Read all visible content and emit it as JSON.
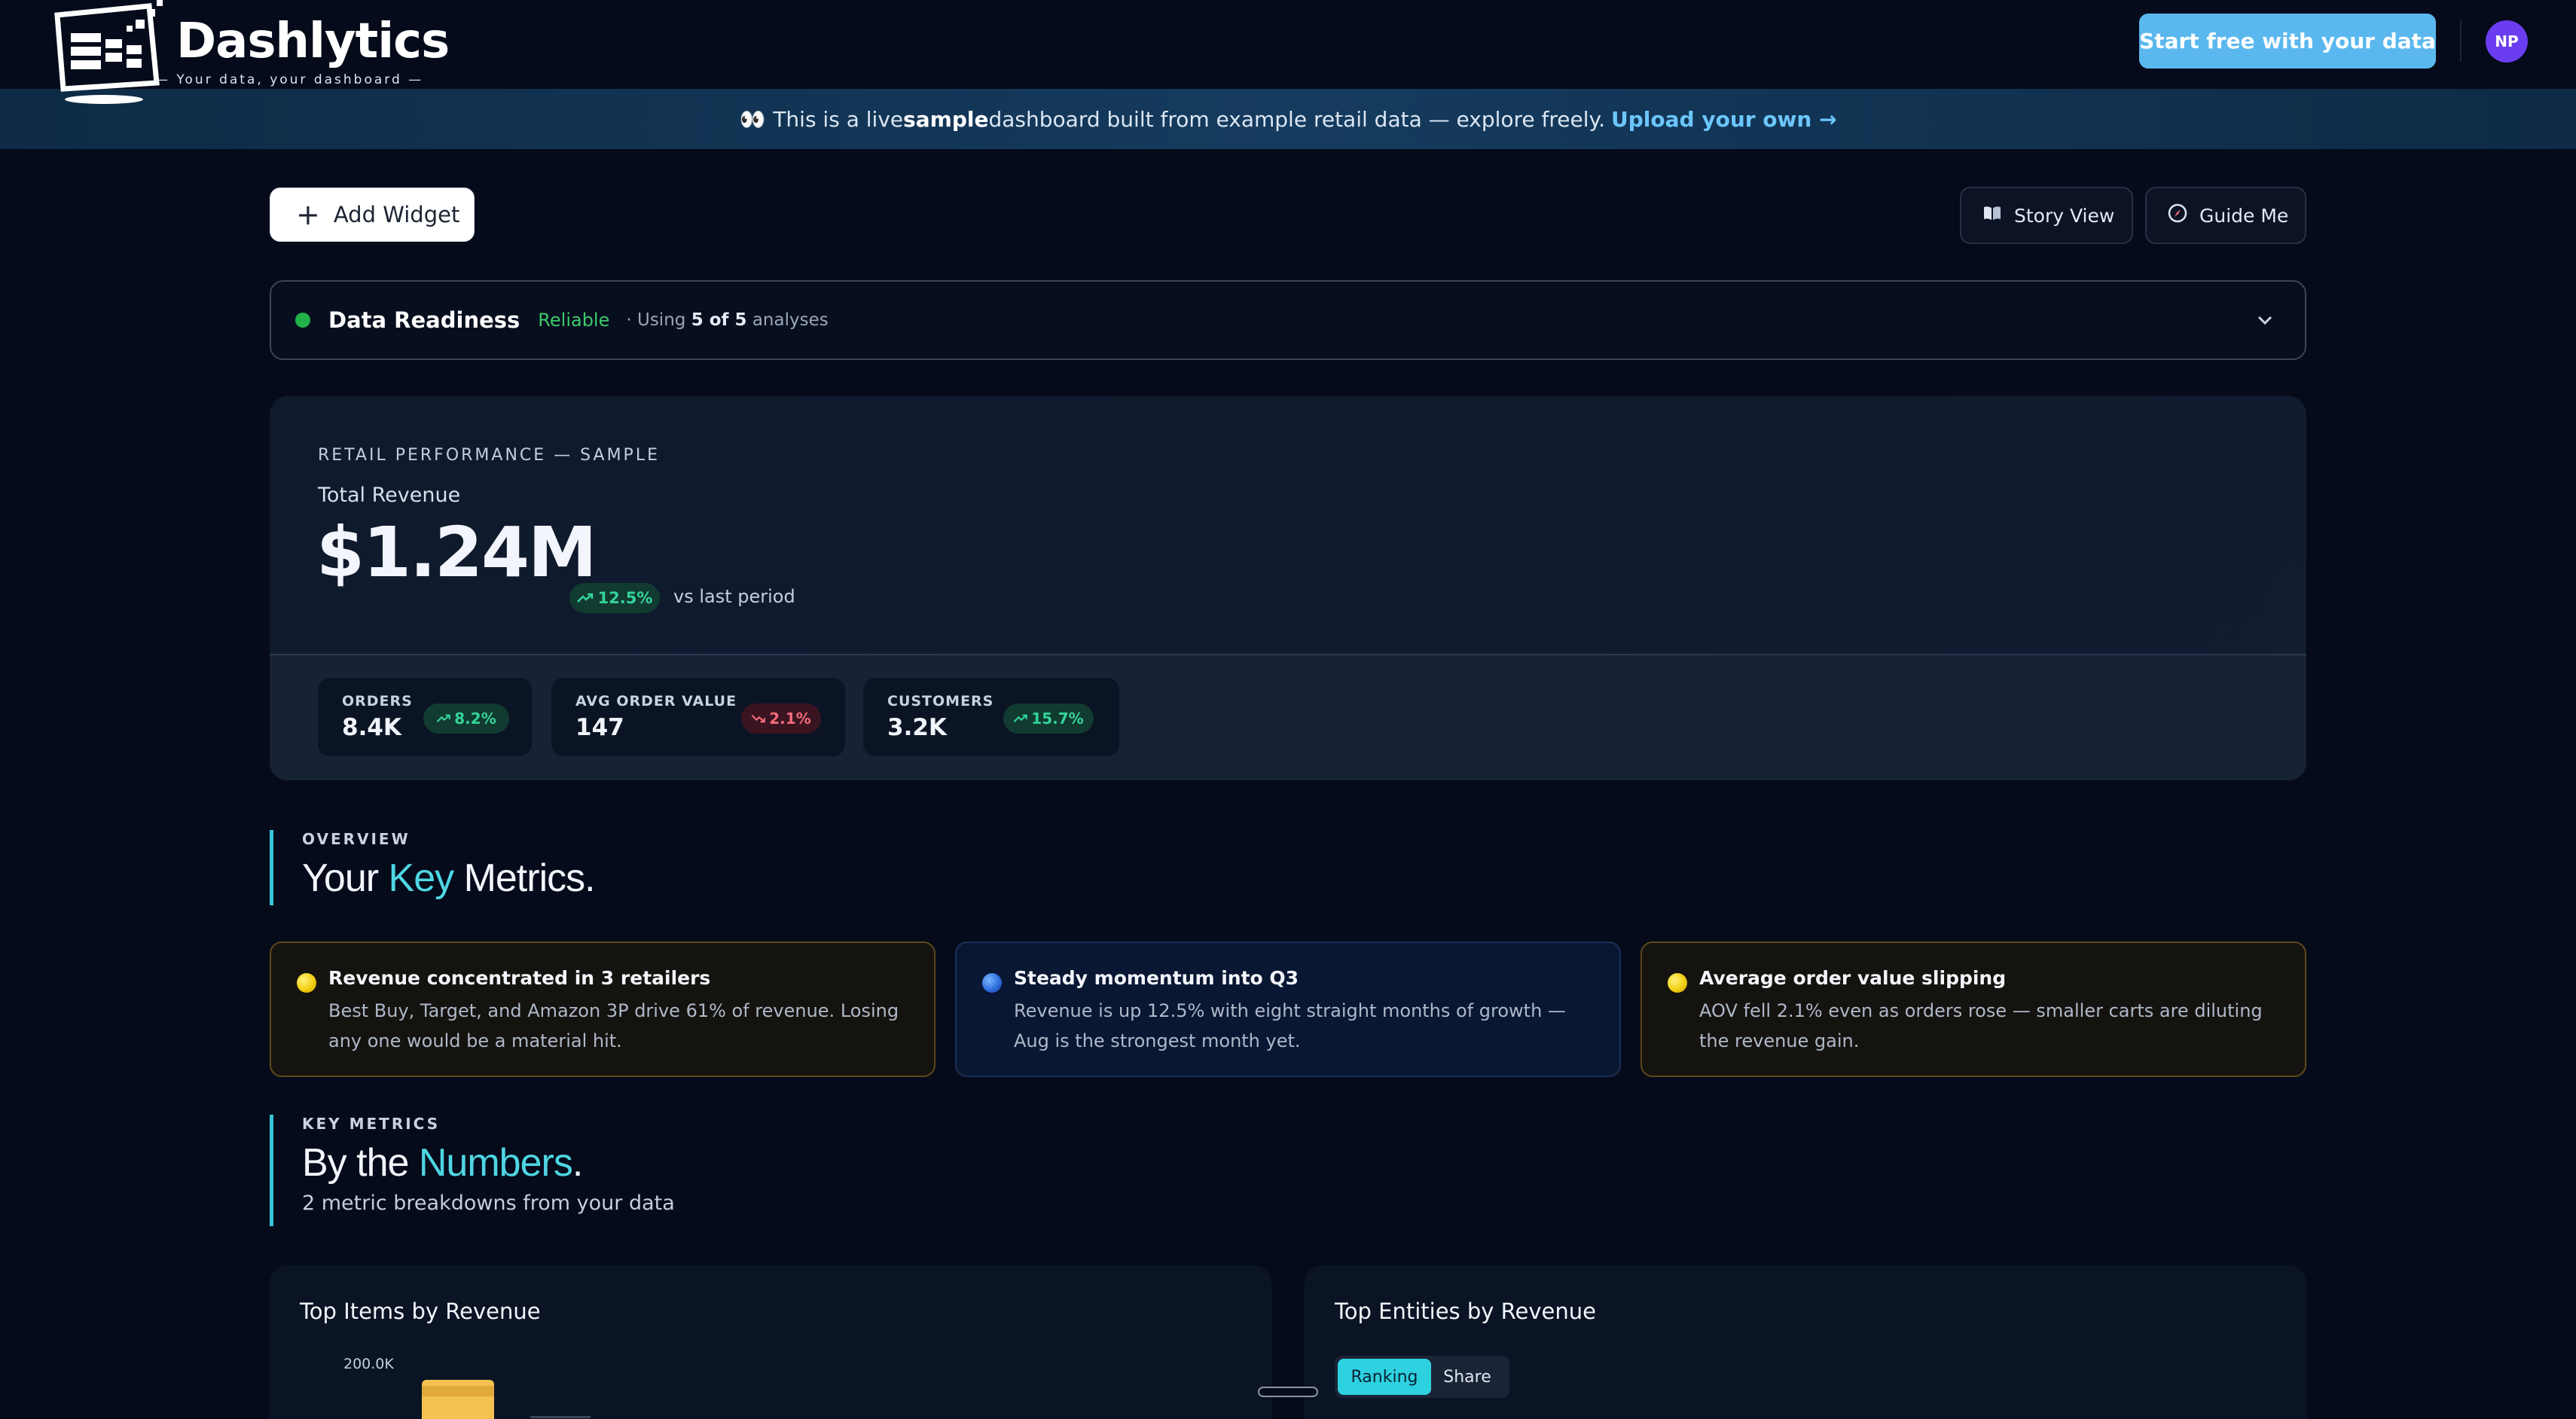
{
  "header": {
    "brand": "Dashlytics",
    "tagline": "— Your data, your dashboard —",
    "cta_label": "Start free with your data",
    "avatar_initials": "NP"
  },
  "banner": {
    "icon": "eyes-emoji",
    "prefix": "This is a live ",
    "bold_word": "sample",
    "suffix": " dashboard built from example retail data — explore freely.",
    "link_label": "Upload your own →"
  },
  "toolbar": {
    "add_widget_label": "Add Widget",
    "story_view_label": "Story View",
    "guide_me_label": "Guide Me"
  },
  "readiness": {
    "title": "Data Readiness",
    "status": "Reliable",
    "note_prefix": "· Using ",
    "note_count": "5 of 5",
    "note_suffix": " analyses"
  },
  "hero": {
    "eyebrow": "RETAIL PERFORMANCE — SAMPLE",
    "label": "Total Revenue",
    "value": "$1.24M",
    "change": "12.5%",
    "change_direction": "up",
    "comparison": "vs last period",
    "kpis": [
      {
        "label": "ORDERS",
        "value": "8.4K",
        "change": "8.2%",
        "direction": "up"
      },
      {
        "label": "AVG ORDER VALUE",
        "value": "147",
        "change": "2.1%",
        "direction": "down"
      },
      {
        "label": "CUSTOMERS",
        "value": "3.2K",
        "change": "15.7%",
        "direction": "up"
      }
    ]
  },
  "overview": {
    "eyebrow": "OVERVIEW",
    "title_pre": "Your ",
    "title_accent": "Key",
    "title_post": " Metrics."
  },
  "insights": [
    {
      "title": "Revenue concentrated in 3 retailers",
      "body": "Best Buy, Target, and Amazon 3P drive 61% of revenue. Losing any one would be a material hit.",
      "tone": "warning"
    },
    {
      "title": "Steady momentum into Q3",
      "body": "Revenue is up 12.5% with eight straight months of growth — Aug is the strongest month yet.",
      "tone": "info"
    },
    {
      "title": "Average order value slipping",
      "body": "AOV fell 2.1% even as orders rose — smaller carts are diluting the revenue gain.",
      "tone": "warning"
    }
  ],
  "key_metrics": {
    "eyebrow": "KEY METRICS",
    "title_pre": "By the ",
    "title_accent": "Numbers",
    "title_post": ".",
    "subtitle": "2 metric breakdowns from your data"
  },
  "charts": {
    "left": {
      "title": "Top Items by Revenue",
      "top_tick": "200.0K"
    },
    "right": {
      "title": "Top Entities by Revenue",
      "toggle": [
        "Ranking",
        "Share"
      ],
      "active_toggle": "Ranking"
    }
  },
  "colors": {
    "accent": "#4fd6e3",
    "cta": "#5ab8ee",
    "positive": "#34d399",
    "negative": "#f26b7a",
    "warning_border": "#5e4717"
  }
}
